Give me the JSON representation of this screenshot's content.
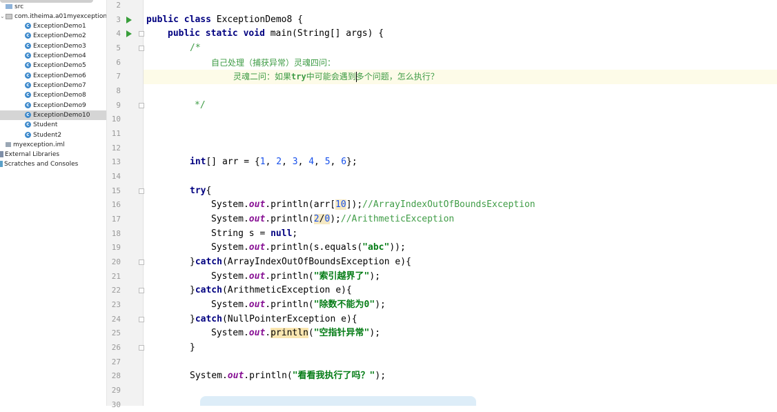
{
  "tree": {
    "items": [
      {
        "label": "src",
        "kind": "folder"
      },
      {
        "label": "com.itheima.a01myexception",
        "kind": "package"
      },
      {
        "label": "ExceptionDemo1",
        "kind": "class"
      },
      {
        "label": "ExceptionDemo2",
        "kind": "class"
      },
      {
        "label": "ExceptionDemo3",
        "kind": "class"
      },
      {
        "label": "ExceptionDemo4",
        "kind": "class"
      },
      {
        "label": "ExceptionDemo5",
        "kind": "class"
      },
      {
        "label": "ExceptionDemo6",
        "kind": "class"
      },
      {
        "label": "ExceptionDemo7",
        "kind": "class"
      },
      {
        "label": "ExceptionDemo8",
        "kind": "class"
      },
      {
        "label": "ExceptionDemo9",
        "kind": "class"
      },
      {
        "label": "ExceptionDemo10",
        "kind": "class",
        "selected": true
      },
      {
        "label": "Student",
        "kind": "class"
      },
      {
        "label": "Student2",
        "kind": "class"
      },
      {
        "label": "myexception.iml",
        "kind": "iml"
      },
      {
        "label": "External Libraries",
        "kind": "lib"
      },
      {
        "label": "Scratches and Consoles",
        "kind": "scratch"
      }
    ]
  },
  "gutter": {
    "line_numbers": [
      "2",
      "3",
      "4",
      "5",
      "6",
      "7",
      "8",
      "9",
      "10",
      "11",
      "12",
      "13",
      "14",
      "15",
      "16",
      "17",
      "18",
      "19",
      "20",
      "21",
      "22",
      "23",
      "24",
      "25",
      "26",
      "27",
      "28",
      "29",
      "30"
    ]
  },
  "code": {
    "l3": {
      "kw1": "public",
      "kw2": "class",
      "name": "ExceptionDemo8 {"
    },
    "l4": {
      "kw1": "public",
      "kw2": "static",
      "kw3": "void",
      "rest": "main(String[] args) {"
    },
    "l5": "/*",
    "l6": "自己处理（捕获异常）灵魂四问：",
    "l7a": "灵魂二问：如果",
    "l7b": "try",
    "l7c": "中可能会遇到多个问题，怎么执行？",
    "l9": "*/",
    "l13": {
      "kw": "int",
      "a": "[] arr = {",
      "n1": "1",
      "n2": "2",
      "n3": "3",
      "n4": "4",
      "n5": "5",
      "n6": "6",
      "end": "};"
    },
    "l15": {
      "kw": "try",
      "rest": "{"
    },
    "l16": {
      "a": "System.",
      "out": "out",
      "b": ".println(arr[",
      "idx": "10",
      "c": "]);",
      "comment": "//ArrayIndexOutOfBoundsException"
    },
    "l17": {
      "a": "System.",
      "out": "out",
      "b": ".println(",
      "n1": "2",
      "slash": "/",
      "n2": "0",
      "c": ");",
      "comment": "//ArithmeticException"
    },
    "l18": {
      "a": "String s = ",
      "kw": "null",
      "c": ";"
    },
    "l19": {
      "a": "System.",
      "out": "out",
      "b": ".println(s.equals(",
      "str": "\"abc\"",
      "c": "));"
    },
    "l20": {
      "a": "}",
      "kw": "catch",
      "b": "(ArrayIndexOutOfBoundsException e){"
    },
    "l21": {
      "a": "System.",
      "out": "out",
      "b": ".println(",
      "str": "\"索引越界了\"",
      "c": ");"
    },
    "l22": {
      "a": "}",
      "kw": "catch",
      "b": "(ArithmeticException e){"
    },
    "l23": {
      "a": "System.",
      "out": "out",
      "b": ".println(",
      "str": "\"除数不能为0\"",
      "c": ");"
    },
    "l24": {
      "a": "}",
      "kw": "catch",
      "b": "(NullPointerException e){"
    },
    "l25": {
      "a": "System.",
      "out": "out",
      "dot": ".",
      "pr": "println",
      "b": "(",
      "str": "\"空指针异常\"",
      "c": ");"
    },
    "l26": "}",
    "l28": {
      "a": "System.",
      "out": "out",
      "b": ".println(",
      "str": "\"看看我执行了吗？\"",
      "c": ");"
    }
  },
  "colors": {
    "keyword": "#0a2fa8",
    "string": "#067d17",
    "comment": "#3f9c46",
    "number": "#1750eb",
    "static_field": "#871094",
    "selection": "#d5d5d5",
    "run_icon": "#389e3a"
  }
}
